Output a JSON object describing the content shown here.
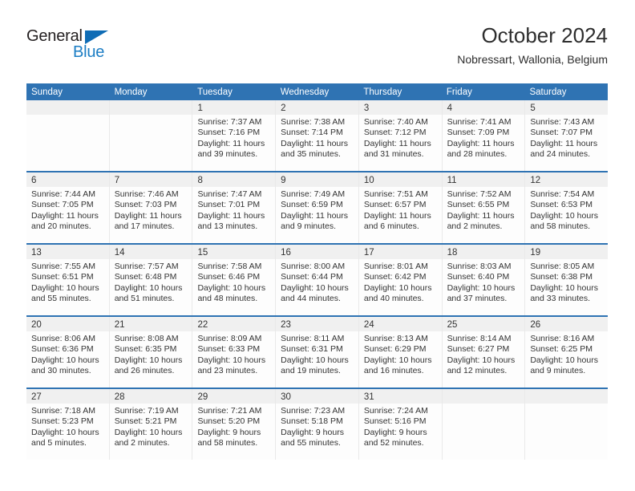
{
  "brand": {
    "logo_text_top": "General",
    "logo_text_bottom": "Blue",
    "logo_colors": {
      "dark": "#231f20",
      "blue": "#1b7dc4",
      "triangle": "#0f6cb5"
    }
  },
  "header": {
    "title": "October 2024",
    "subtitle": "Nobressart, Wallonia, Belgium"
  },
  "theme": {
    "header_blue": "#2f73b3",
    "daynum_band": "#f0f0f0",
    "cell_bg": "#fdfdfd",
    "text": "#333333"
  },
  "weekday_headers": [
    "Sunday",
    "Monday",
    "Tuesday",
    "Wednesday",
    "Thursday",
    "Friday",
    "Saturday"
  ],
  "weeks": [
    [
      {
        "day": "",
        "sunrise": "",
        "sunset": "",
        "daylight_line1": "",
        "daylight_line2": ""
      },
      {
        "day": "",
        "sunrise": "",
        "sunset": "",
        "daylight_line1": "",
        "daylight_line2": ""
      },
      {
        "day": "1",
        "sunrise": "Sunrise: 7:37 AM",
        "sunset": "Sunset: 7:16 PM",
        "daylight_line1": "Daylight: 11 hours",
        "daylight_line2": "and 39 minutes."
      },
      {
        "day": "2",
        "sunrise": "Sunrise: 7:38 AM",
        "sunset": "Sunset: 7:14 PM",
        "daylight_line1": "Daylight: 11 hours",
        "daylight_line2": "and 35 minutes."
      },
      {
        "day": "3",
        "sunrise": "Sunrise: 7:40 AM",
        "sunset": "Sunset: 7:12 PM",
        "daylight_line1": "Daylight: 11 hours",
        "daylight_line2": "and 31 minutes."
      },
      {
        "day": "4",
        "sunrise": "Sunrise: 7:41 AM",
        "sunset": "Sunset: 7:09 PM",
        "daylight_line1": "Daylight: 11 hours",
        "daylight_line2": "and 28 minutes."
      },
      {
        "day": "5",
        "sunrise": "Sunrise: 7:43 AM",
        "sunset": "Sunset: 7:07 PM",
        "daylight_line1": "Daylight: 11 hours",
        "daylight_line2": "and 24 minutes."
      }
    ],
    [
      {
        "day": "6",
        "sunrise": "Sunrise: 7:44 AM",
        "sunset": "Sunset: 7:05 PM",
        "daylight_line1": "Daylight: 11 hours",
        "daylight_line2": "and 20 minutes."
      },
      {
        "day": "7",
        "sunrise": "Sunrise: 7:46 AM",
        "sunset": "Sunset: 7:03 PM",
        "daylight_line1": "Daylight: 11 hours",
        "daylight_line2": "and 17 minutes."
      },
      {
        "day": "8",
        "sunrise": "Sunrise: 7:47 AM",
        "sunset": "Sunset: 7:01 PM",
        "daylight_line1": "Daylight: 11 hours",
        "daylight_line2": "and 13 minutes."
      },
      {
        "day": "9",
        "sunrise": "Sunrise: 7:49 AM",
        "sunset": "Sunset: 6:59 PM",
        "daylight_line1": "Daylight: 11 hours",
        "daylight_line2": "and 9 minutes."
      },
      {
        "day": "10",
        "sunrise": "Sunrise: 7:51 AM",
        "sunset": "Sunset: 6:57 PM",
        "daylight_line1": "Daylight: 11 hours",
        "daylight_line2": "and 6 minutes."
      },
      {
        "day": "11",
        "sunrise": "Sunrise: 7:52 AM",
        "sunset": "Sunset: 6:55 PM",
        "daylight_line1": "Daylight: 11 hours",
        "daylight_line2": "and 2 minutes."
      },
      {
        "day": "12",
        "sunrise": "Sunrise: 7:54 AM",
        "sunset": "Sunset: 6:53 PM",
        "daylight_line1": "Daylight: 10 hours",
        "daylight_line2": "and 58 minutes."
      }
    ],
    [
      {
        "day": "13",
        "sunrise": "Sunrise: 7:55 AM",
        "sunset": "Sunset: 6:51 PM",
        "daylight_line1": "Daylight: 10 hours",
        "daylight_line2": "and 55 minutes."
      },
      {
        "day": "14",
        "sunrise": "Sunrise: 7:57 AM",
        "sunset": "Sunset: 6:48 PM",
        "daylight_line1": "Daylight: 10 hours",
        "daylight_line2": "and 51 minutes."
      },
      {
        "day": "15",
        "sunrise": "Sunrise: 7:58 AM",
        "sunset": "Sunset: 6:46 PM",
        "daylight_line1": "Daylight: 10 hours",
        "daylight_line2": "and 48 minutes."
      },
      {
        "day": "16",
        "sunrise": "Sunrise: 8:00 AM",
        "sunset": "Sunset: 6:44 PM",
        "daylight_line1": "Daylight: 10 hours",
        "daylight_line2": "and 44 minutes."
      },
      {
        "day": "17",
        "sunrise": "Sunrise: 8:01 AM",
        "sunset": "Sunset: 6:42 PM",
        "daylight_line1": "Daylight: 10 hours",
        "daylight_line2": "and 40 minutes."
      },
      {
        "day": "18",
        "sunrise": "Sunrise: 8:03 AM",
        "sunset": "Sunset: 6:40 PM",
        "daylight_line1": "Daylight: 10 hours",
        "daylight_line2": "and 37 minutes."
      },
      {
        "day": "19",
        "sunrise": "Sunrise: 8:05 AM",
        "sunset": "Sunset: 6:38 PM",
        "daylight_line1": "Daylight: 10 hours",
        "daylight_line2": "and 33 minutes."
      }
    ],
    [
      {
        "day": "20",
        "sunrise": "Sunrise: 8:06 AM",
        "sunset": "Sunset: 6:36 PM",
        "daylight_line1": "Daylight: 10 hours",
        "daylight_line2": "and 30 minutes."
      },
      {
        "day": "21",
        "sunrise": "Sunrise: 8:08 AM",
        "sunset": "Sunset: 6:35 PM",
        "daylight_line1": "Daylight: 10 hours",
        "daylight_line2": "and 26 minutes."
      },
      {
        "day": "22",
        "sunrise": "Sunrise: 8:09 AM",
        "sunset": "Sunset: 6:33 PM",
        "daylight_line1": "Daylight: 10 hours",
        "daylight_line2": "and 23 minutes."
      },
      {
        "day": "23",
        "sunrise": "Sunrise: 8:11 AM",
        "sunset": "Sunset: 6:31 PM",
        "daylight_line1": "Daylight: 10 hours",
        "daylight_line2": "and 19 minutes."
      },
      {
        "day": "24",
        "sunrise": "Sunrise: 8:13 AM",
        "sunset": "Sunset: 6:29 PM",
        "daylight_line1": "Daylight: 10 hours",
        "daylight_line2": "and 16 minutes."
      },
      {
        "day": "25",
        "sunrise": "Sunrise: 8:14 AM",
        "sunset": "Sunset: 6:27 PM",
        "daylight_line1": "Daylight: 10 hours",
        "daylight_line2": "and 12 minutes."
      },
      {
        "day": "26",
        "sunrise": "Sunrise: 8:16 AM",
        "sunset": "Sunset: 6:25 PM",
        "daylight_line1": "Daylight: 10 hours",
        "daylight_line2": "and 9 minutes."
      }
    ],
    [
      {
        "day": "27",
        "sunrise": "Sunrise: 7:18 AM",
        "sunset": "Sunset: 5:23 PM",
        "daylight_line1": "Daylight: 10 hours",
        "daylight_line2": "and 5 minutes."
      },
      {
        "day": "28",
        "sunrise": "Sunrise: 7:19 AM",
        "sunset": "Sunset: 5:21 PM",
        "daylight_line1": "Daylight: 10 hours",
        "daylight_line2": "and 2 minutes."
      },
      {
        "day": "29",
        "sunrise": "Sunrise: 7:21 AM",
        "sunset": "Sunset: 5:20 PM",
        "daylight_line1": "Daylight: 9 hours",
        "daylight_line2": "and 58 minutes."
      },
      {
        "day": "30",
        "sunrise": "Sunrise: 7:23 AM",
        "sunset": "Sunset: 5:18 PM",
        "daylight_line1": "Daylight: 9 hours",
        "daylight_line2": "and 55 minutes."
      },
      {
        "day": "31",
        "sunrise": "Sunrise: 7:24 AM",
        "sunset": "Sunset: 5:16 PM",
        "daylight_line1": "Daylight: 9 hours",
        "daylight_line2": "and 52 minutes."
      },
      {
        "day": "",
        "sunrise": "",
        "sunset": "",
        "daylight_line1": "",
        "daylight_line2": ""
      },
      {
        "day": "",
        "sunrise": "",
        "sunset": "",
        "daylight_line1": "",
        "daylight_line2": ""
      }
    ]
  ]
}
